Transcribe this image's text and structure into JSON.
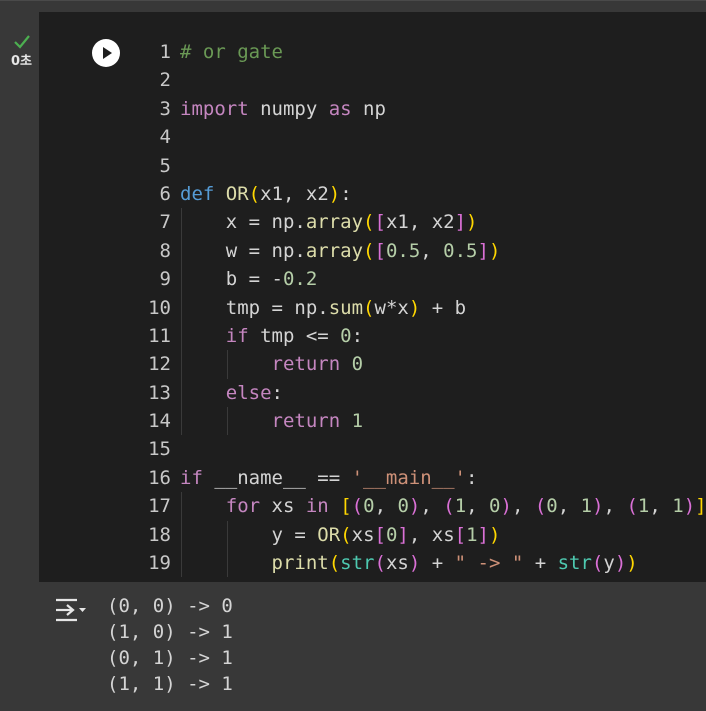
{
  "cell": {
    "exec_time": "0초",
    "status": "success",
    "colors": {
      "background": "#383838",
      "editor_bg": "#1e1e1e",
      "check": "#4caf50",
      "comment": "#6a9955",
      "keyword": "#c586c0",
      "def_keyword": "#569cd6",
      "function": "#dcdcaa",
      "number": "#b5cea8",
      "string": "#ce9178",
      "builtin": "#4ec9b0",
      "bracket_1": "#ffd700",
      "bracket_2": "#da70d6",
      "bracket_3": "#179fff"
    },
    "icons": [
      "check-icon",
      "run-icon",
      "output-toggle-icon"
    ],
    "code_lines": [
      {
        "n": "1",
        "t": [
          [
            "# or gate",
            "com"
          ]
        ]
      },
      {
        "n": "2",
        "t": []
      },
      {
        "n": "3",
        "t": [
          [
            "import",
            "kw"
          ],
          [
            " numpy ",
            "txt"
          ],
          [
            "as",
            "kw"
          ],
          [
            " np",
            "txt"
          ]
        ]
      },
      {
        "n": "4",
        "t": []
      },
      {
        "n": "5",
        "t": []
      },
      {
        "n": "6",
        "t": [
          [
            "def",
            "def"
          ],
          [
            " ",
            "txt"
          ],
          [
            "OR",
            "fn"
          ],
          [
            "(",
            "p1"
          ],
          [
            "x1, x2",
            "txt"
          ],
          [
            ")",
            "p1"
          ],
          [
            ":",
            "txt"
          ]
        ]
      },
      {
        "n": "7",
        "t": [
          [
            "    x = np.",
            "txt"
          ],
          [
            "array",
            "fn"
          ],
          [
            "(",
            "p1"
          ],
          [
            "[",
            "p2"
          ],
          [
            "x1, x2",
            "txt"
          ],
          [
            "]",
            "p2"
          ],
          [
            ")",
            "p1"
          ]
        ]
      },
      {
        "n": "8",
        "t": [
          [
            "    w = np.",
            "txt"
          ],
          [
            "array",
            "fn"
          ],
          [
            "(",
            "p1"
          ],
          [
            "[",
            "p2"
          ],
          [
            "0.5",
            "num"
          ],
          [
            ", ",
            "txt"
          ],
          [
            "0.5",
            "num"
          ],
          [
            "]",
            "p2"
          ],
          [
            ")",
            "p1"
          ]
        ]
      },
      {
        "n": "9",
        "t": [
          [
            "    b = -",
            "txt"
          ],
          [
            "0.2",
            "num"
          ]
        ]
      },
      {
        "n": "10",
        "t": [
          [
            "    tmp = np.",
            "txt"
          ],
          [
            "sum",
            "fn"
          ],
          [
            "(",
            "p1"
          ],
          [
            "w*x",
            "txt"
          ],
          [
            ")",
            "p1"
          ],
          [
            " + b",
            "txt"
          ]
        ]
      },
      {
        "n": "11",
        "t": [
          [
            "    ",
            "txt"
          ],
          [
            "if",
            "kw"
          ],
          [
            " tmp <= ",
            "txt"
          ],
          [
            "0",
            "num"
          ],
          [
            ":",
            "txt"
          ]
        ]
      },
      {
        "n": "12",
        "t": [
          [
            "        ",
            "txt"
          ],
          [
            "return",
            "kw"
          ],
          [
            " ",
            "txt"
          ],
          [
            "0",
            "num"
          ]
        ]
      },
      {
        "n": "13",
        "t": [
          [
            "    ",
            "txt"
          ],
          [
            "else",
            "kw"
          ],
          [
            ":",
            "txt"
          ]
        ]
      },
      {
        "n": "14",
        "t": [
          [
            "        ",
            "txt"
          ],
          [
            "return",
            "kw"
          ],
          [
            " ",
            "txt"
          ],
          [
            "1",
            "num"
          ]
        ]
      },
      {
        "n": "15",
        "t": []
      },
      {
        "n": "16",
        "t": [
          [
            "if",
            "kw"
          ],
          [
            " __name__ == ",
            "txt"
          ],
          [
            "'__main__'",
            "str"
          ],
          [
            ":",
            "txt"
          ]
        ]
      },
      {
        "n": "17",
        "t": [
          [
            "    ",
            "txt"
          ],
          [
            "for",
            "kw"
          ],
          [
            " xs ",
            "txt"
          ],
          [
            "in",
            "kw"
          ],
          [
            " ",
            "txt"
          ],
          [
            "[",
            "p1"
          ],
          [
            "(",
            "p2"
          ],
          [
            "0",
            "num"
          ],
          [
            ", ",
            "txt"
          ],
          [
            "0",
            "num"
          ],
          [
            ")",
            "p2"
          ],
          [
            ", ",
            "txt"
          ],
          [
            "(",
            "p2"
          ],
          [
            "1",
            "num"
          ],
          [
            ", ",
            "txt"
          ],
          [
            "0",
            "num"
          ],
          [
            ")",
            "p2"
          ],
          [
            ", ",
            "txt"
          ],
          [
            "(",
            "p2"
          ],
          [
            "0",
            "num"
          ],
          [
            ", ",
            "txt"
          ],
          [
            "1",
            "num"
          ],
          [
            ")",
            "p2"
          ],
          [
            ", ",
            "txt"
          ],
          [
            "(",
            "p2"
          ],
          [
            "1",
            "num"
          ],
          [
            ", ",
            "txt"
          ],
          [
            "1",
            "num"
          ],
          [
            ")",
            "p2"
          ],
          [
            "]",
            "p1"
          ],
          [
            ":",
            "txt"
          ]
        ]
      },
      {
        "n": "18",
        "t": [
          [
            "        y = ",
            "txt"
          ],
          [
            "OR",
            "fn"
          ],
          [
            "(",
            "p1"
          ],
          [
            "xs",
            "txt"
          ],
          [
            "[",
            "p2"
          ],
          [
            "0",
            "num"
          ],
          [
            "]",
            "p2"
          ],
          [
            ", xs",
            "txt"
          ],
          [
            "[",
            "p2"
          ],
          [
            "1",
            "num"
          ],
          [
            "]",
            "p2"
          ],
          [
            ")",
            "p1"
          ]
        ]
      },
      {
        "n": "19",
        "t": [
          [
            "        ",
            "txt"
          ],
          [
            "print",
            "fn"
          ],
          [
            "(",
            "p1"
          ],
          [
            "str",
            "bi"
          ],
          [
            "(",
            "p2"
          ],
          [
            "xs",
            "txt"
          ],
          [
            ")",
            "p2"
          ],
          [
            " + ",
            "txt"
          ],
          [
            "\" -> \"",
            "str"
          ],
          [
            " + ",
            "txt"
          ],
          [
            "str",
            "bi"
          ],
          [
            "(",
            "p2"
          ],
          [
            "y",
            "txt"
          ],
          [
            ")",
            "p2"
          ],
          [
            ")",
            "p1"
          ]
        ]
      }
    ],
    "output_lines": [
      "(0, 0) -> 0",
      "(1, 0) -> 1",
      "(0, 1) -> 1",
      "(1, 1) -> 1"
    ]
  }
}
